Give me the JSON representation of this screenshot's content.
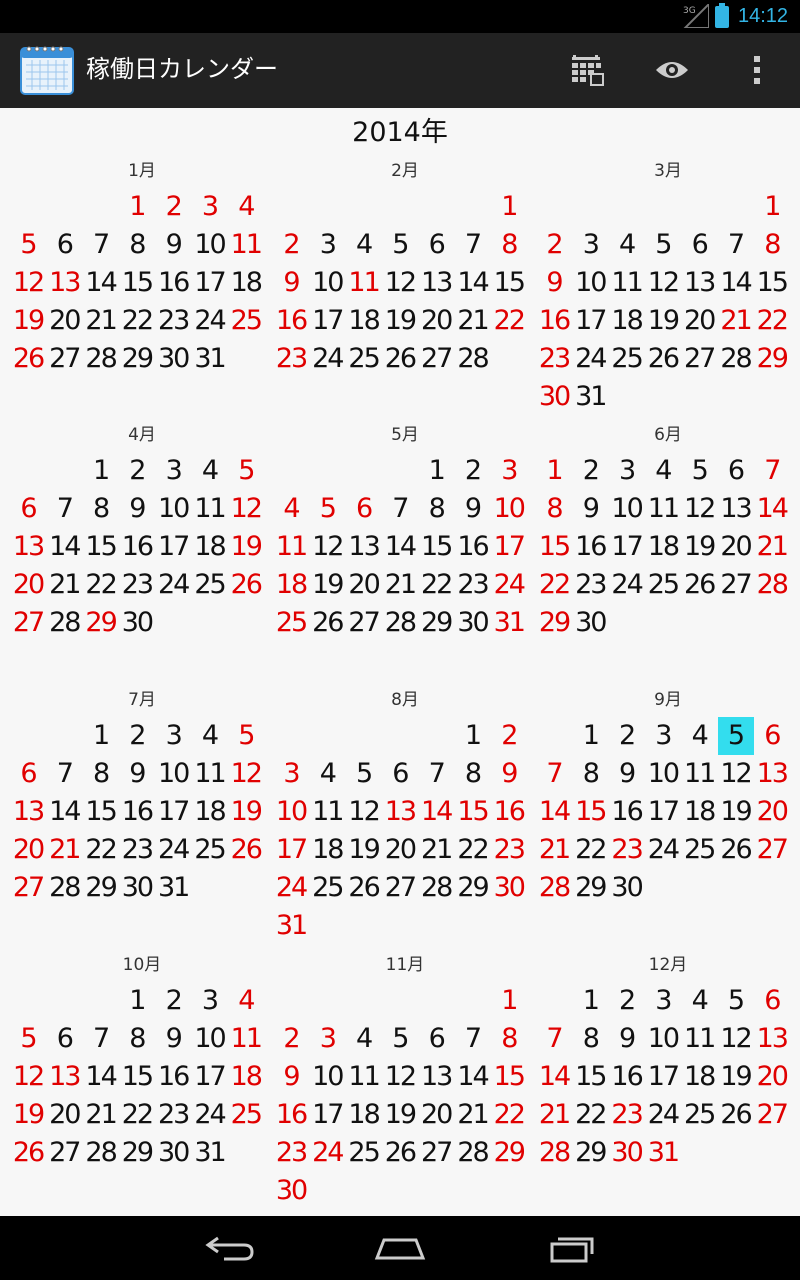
{
  "status_bar": {
    "network": "3G",
    "time": "14:12",
    "accent_color": "#33b5e5"
  },
  "action_bar": {
    "title": "稼働日カレンダー",
    "app_icon": "calendar-icon",
    "actions": [
      {
        "name": "calendar-grid-button",
        "icon": "calendar-grid-icon"
      },
      {
        "name": "view-button",
        "icon": "eye-icon"
      },
      {
        "name": "overflow-menu-button",
        "icon": "overflow-menu-icon"
      }
    ]
  },
  "calendar": {
    "year_label": "2014年",
    "holiday_color": "#e00000",
    "today_color": "#33ddee",
    "months": [
      {
        "label": "1月",
        "start": 3,
        "days": 31,
        "holidays": [
          1,
          2,
          3,
          4,
          5,
          11,
          12,
          13,
          19,
          25,
          26
        ]
      },
      {
        "label": "2月",
        "start": 6,
        "days": 28,
        "holidays": [
          1,
          2,
          8,
          9,
          11,
          16,
          22,
          23
        ]
      },
      {
        "label": "3月",
        "start": 6,
        "days": 31,
        "holidays": [
          1,
          2,
          8,
          9,
          16,
          21,
          22,
          23,
          29,
          30
        ]
      },
      {
        "label": "4月",
        "start": 2,
        "days": 30,
        "holidays": [
          5,
          6,
          12,
          13,
          19,
          20,
          26,
          27,
          29
        ]
      },
      {
        "label": "5月",
        "start": 4,
        "days": 31,
        "holidays": [
          3,
          4,
          5,
          6,
          10,
          11,
          17,
          18,
          24,
          25,
          31
        ]
      },
      {
        "label": "6月",
        "start": 0,
        "days": 30,
        "holidays": [
          1,
          7,
          8,
          14,
          15,
          21,
          22,
          28,
          29
        ]
      },
      {
        "label": "7月",
        "start": 2,
        "days": 31,
        "holidays": [
          5,
          6,
          12,
          13,
          19,
          20,
          21,
          26,
          27
        ]
      },
      {
        "label": "8月",
        "start": 5,
        "days": 31,
        "holidays": [
          2,
          3,
          9,
          10,
          13,
          14,
          15,
          16,
          17,
          23,
          24,
          30,
          31
        ]
      },
      {
        "label": "9月",
        "start": 1,
        "days": 30,
        "holidays": [
          6,
          7,
          13,
          14,
          15,
          20,
          21,
          23,
          27,
          28
        ],
        "today": 5
      },
      {
        "label": "10月",
        "start": 3,
        "days": 31,
        "holidays": [
          4,
          5,
          11,
          12,
          13,
          18,
          19,
          25,
          26
        ]
      },
      {
        "label": "11月",
        "start": 6,
        "days": 30,
        "holidays": [
          1,
          2,
          3,
          8,
          9,
          15,
          16,
          22,
          23,
          24,
          29,
          30
        ]
      },
      {
        "label": "12月",
        "start": 1,
        "days": 31,
        "holidays": [
          6,
          7,
          13,
          14,
          20,
          21,
          23,
          27,
          28,
          30,
          31
        ]
      }
    ]
  },
  "nav_bar": {
    "buttons": [
      {
        "name": "back-button",
        "icon": "back-icon"
      },
      {
        "name": "home-button",
        "icon": "home-icon"
      },
      {
        "name": "recents-button",
        "icon": "recents-icon"
      }
    ]
  }
}
